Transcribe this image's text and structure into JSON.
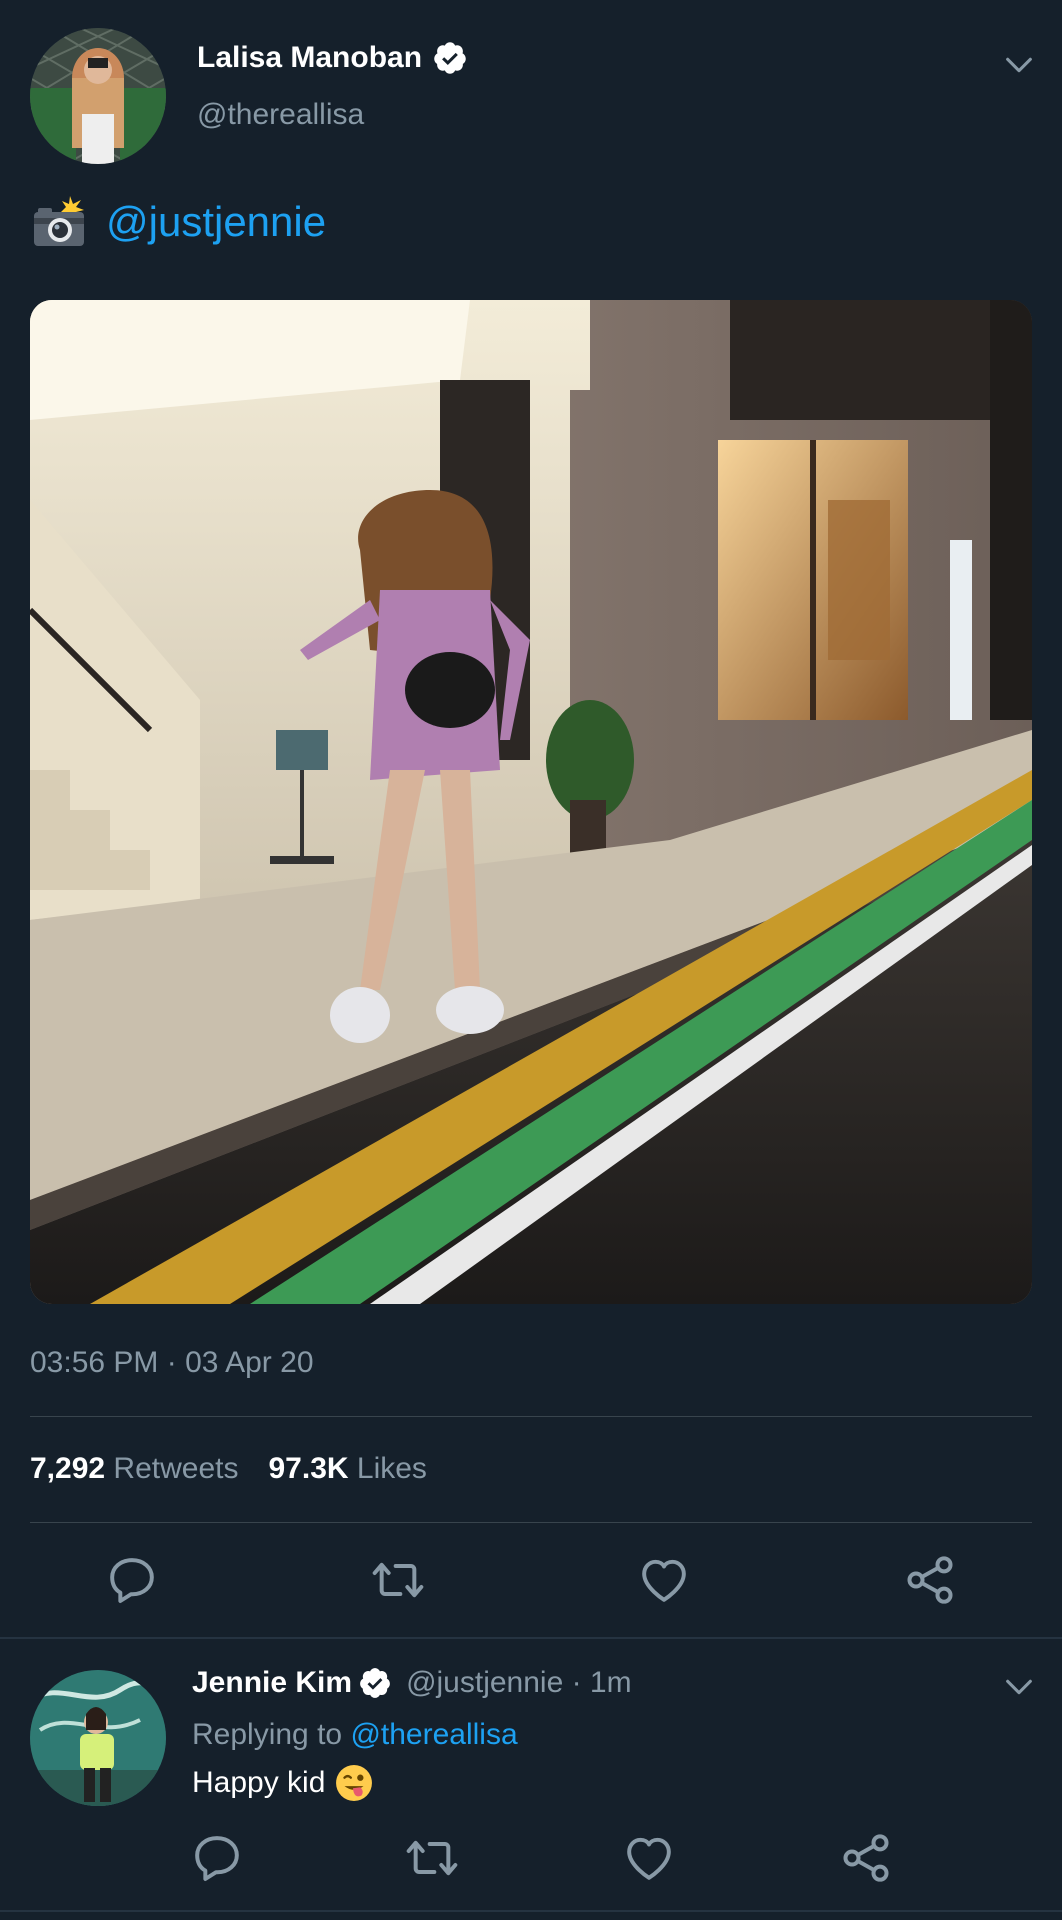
{
  "main_tweet": {
    "display_name": "Lalisa Manoban",
    "handle": "@thereallisa",
    "text_icon": "camera-with-flash-icon",
    "text_mention": "@justjennie",
    "timestamp": "03:56 PM · 03 Apr 20",
    "retweets_count": "7,292",
    "retweets_label": "Retweets",
    "likes_count": "97.3K",
    "likes_label": "Likes",
    "actions": [
      "reply-icon",
      "retweet-icon",
      "like-icon",
      "share-icon"
    ]
  },
  "reply_tweet": {
    "display_name": "Jennie Kim",
    "handle_time": "@justjennie · 1m",
    "replying_prefix": "Replying to ",
    "replying_to": "@thereallisa",
    "text": "Happy kid",
    "emoji": "winking-face-with-tongue-icon",
    "actions": [
      "reply-icon",
      "retweet-icon",
      "like-icon",
      "share-icon"
    ]
  },
  "colors": {
    "background": "#15202b",
    "primary_text": "#ffffff",
    "secondary_text": "#8899a6",
    "accent": "#1da1f2",
    "divider": "#38444d"
  }
}
